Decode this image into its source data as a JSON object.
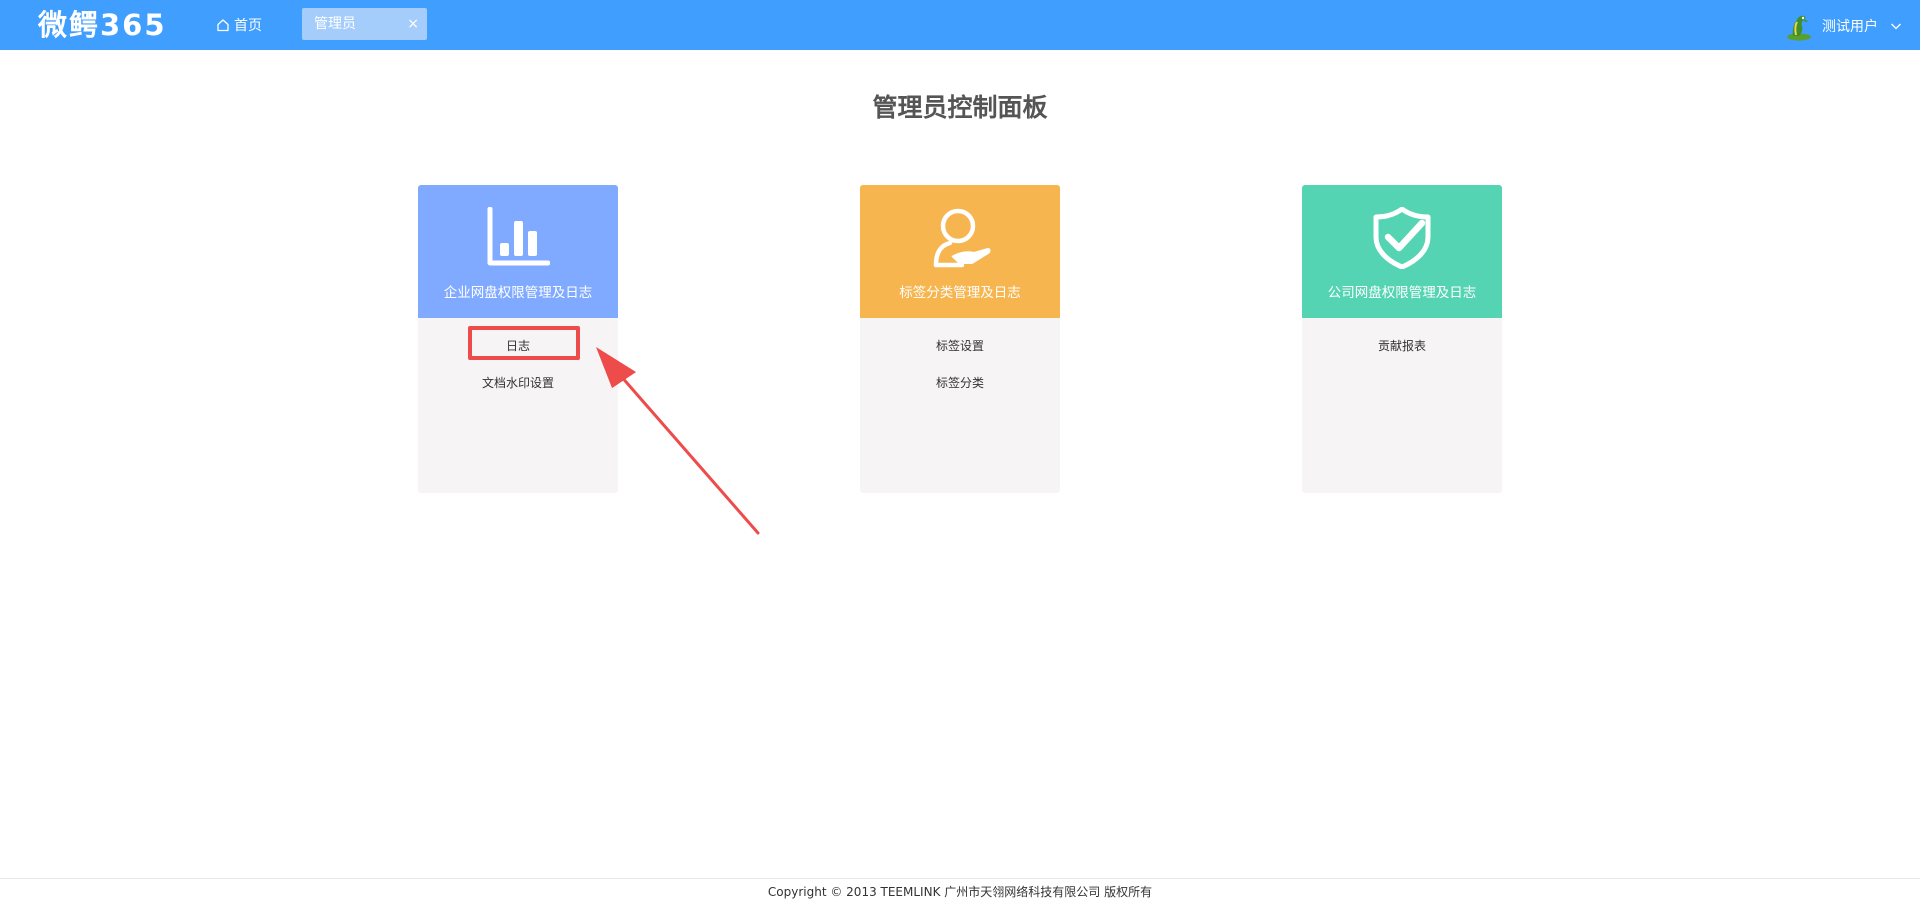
{
  "header": {
    "logo": "微鳄365",
    "home_label": "首页",
    "tab_label": "管理员",
    "tab_close": "×",
    "user_name": "测试用户",
    "bar_color": "#409eff"
  },
  "page": {
    "title": "管理员控制面板"
  },
  "cards": [
    {
      "title": "企业网盘权限管理及日志",
      "icon": "bar-chart-icon",
      "color": "#80aaff",
      "links": [
        "日志",
        "文档水印设置"
      ]
    },
    {
      "title": "标签分类管理及日志",
      "icon": "user-hand-icon",
      "color": "#f6b54e",
      "links": [
        "标签设置",
        "标签分类"
      ]
    },
    {
      "title": "公司网盘权限管理及日志",
      "icon": "shield-check-icon",
      "color": "#54d4b2",
      "links": [
        "贡献报表"
      ]
    }
  ],
  "annotation": {
    "highlighted_item": "日志",
    "color": "#ee4b4b"
  },
  "footer": {
    "text": "Copyright © 2013 TEEMLINK 广州市天翎网络科技有限公司 版权所有"
  }
}
